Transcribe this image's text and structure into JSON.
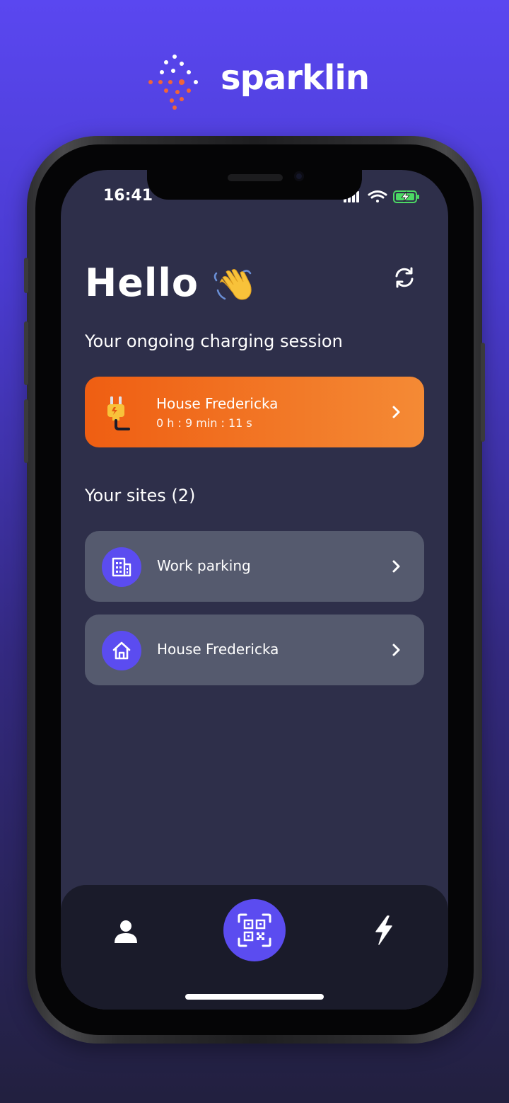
{
  "brand": {
    "name": "sparklin",
    "logo_icon": "sparkle-dots-logo",
    "accent_color": "#f0643a"
  },
  "status_bar": {
    "time": "16:41",
    "icons": [
      "cellular-signal-icon",
      "wifi-icon",
      "battery-charging-icon"
    ]
  },
  "header": {
    "greeting": "Hello",
    "greeting_icon": "waving-hand-icon",
    "refresh_icon": "refresh-icon"
  },
  "ongoing_session": {
    "section_title": "Your ongoing charging session",
    "site_name": "House Fredericka",
    "duration": "0 h : 9 min : 11 s",
    "icon": "plug-icon",
    "color_start": "#ef5e12",
    "color_end": "#f48a35"
  },
  "sites": {
    "section_title": "Your sites (2)",
    "items": [
      {
        "label": "Work parking",
        "icon": "office-building-icon"
      },
      {
        "label": "House Fredericka",
        "icon": "home-icon"
      }
    ]
  },
  "bottom_nav": {
    "items": [
      {
        "icon": "user-icon"
      },
      {
        "icon": "qr-code-scan-icon"
      },
      {
        "icon": "lightning-icon"
      }
    ],
    "accent": "#5b4cf0"
  }
}
